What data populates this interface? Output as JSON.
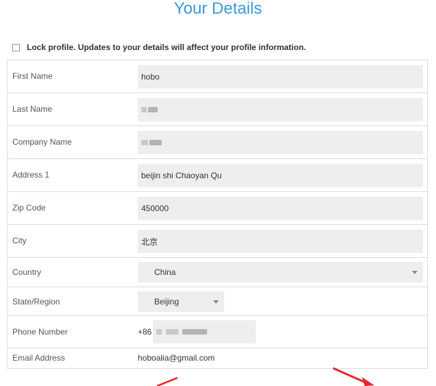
{
  "page": {
    "title": "Your Details"
  },
  "lock_profile": {
    "label": "Lock profile. Updates to your details will affect your profile information.",
    "checked": false
  },
  "fields": {
    "first_name": {
      "label": "First Name",
      "value": "hobo"
    },
    "last_name": {
      "label": "Last Name",
      "value": ""
    },
    "company_name": {
      "label": "Company Name",
      "value": ""
    },
    "address1": {
      "label": "Address 1",
      "value": "beijin shi Chaoyan Qu"
    },
    "zip_code": {
      "label": "Zip Code",
      "value": "450000"
    },
    "city": {
      "label": "City",
      "value": "北京"
    },
    "country": {
      "label": "Country",
      "value": "China"
    },
    "state_region": {
      "label": "State/Region",
      "value": "Beijing"
    },
    "phone_number": {
      "label": "Phone Number",
      "prefix": "+86",
      "value": ""
    },
    "email_address": {
      "label": "Email Address",
      "value": "hoboalia@gmail.com"
    }
  },
  "colors": {
    "title": "#3a9ad9",
    "field_bg": "#eeeeee",
    "border": "#dcdcdc",
    "annotation_arrow": "#e8252a"
  }
}
